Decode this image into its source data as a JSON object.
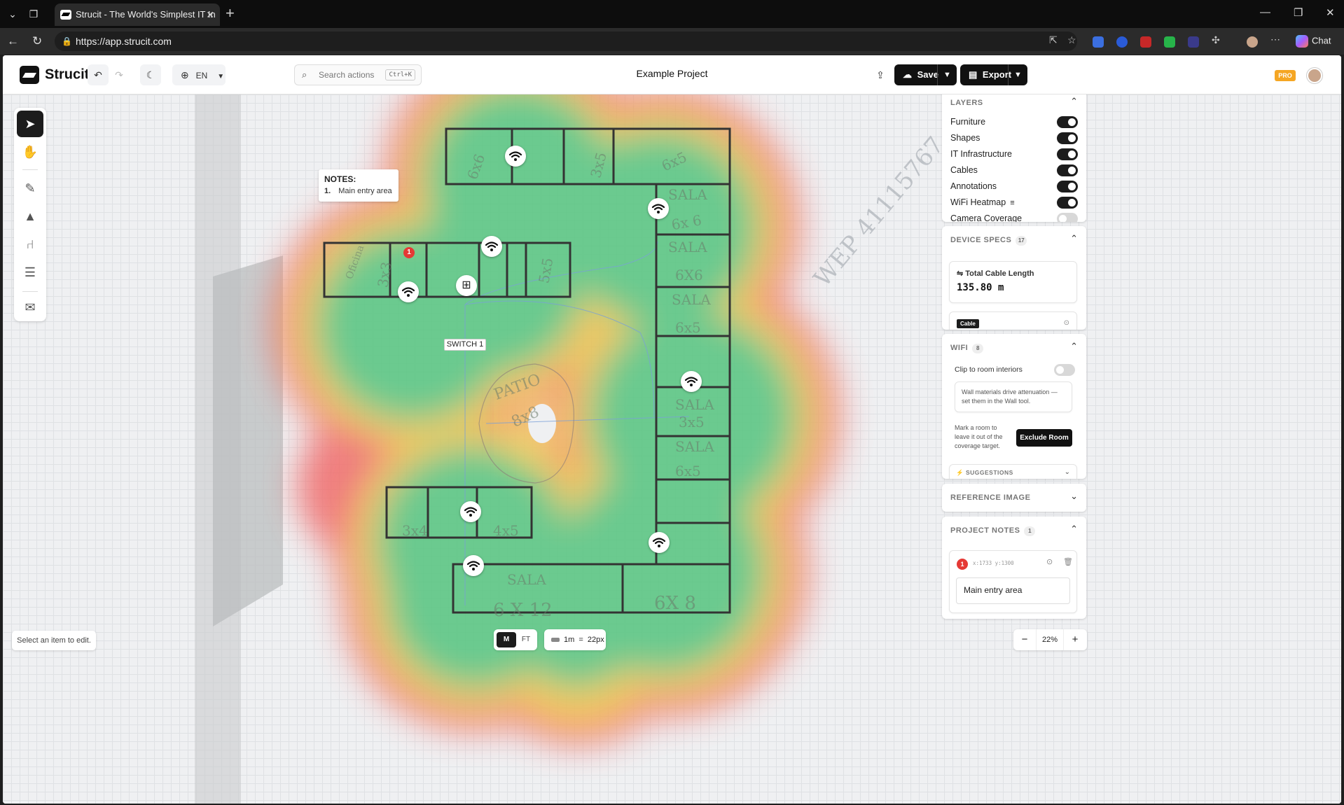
{
  "browser": {
    "tab_title": "Strucit - The World's Simplest IT In",
    "url": "https://app.strucit.com",
    "chat_label": "Chat"
  },
  "app": {
    "logo_text": "Strucit",
    "language": "EN",
    "search_placeholder": "Search actions",
    "search_shortcut": "Ctrl+K",
    "project_title": "Example Project",
    "save_label": "Save",
    "export_label": "Export",
    "plan_badge": "PRO"
  },
  "canvas": {
    "notes_title": "NOTES:",
    "notes_items": [
      {
        "num": "1.",
        "text": "Main entry area"
      }
    ],
    "switch_label": "SWITCH 1",
    "note_marker": "1",
    "handwritten_label": "WEP 41115767",
    "status_text": "Select an item to edit.",
    "units": {
      "metric": "M",
      "imperial": "FT",
      "active": "M"
    },
    "scale_text": "1m  =  22px",
    "zoom": "22%"
  },
  "layers": {
    "title": "LAYERS",
    "items": [
      {
        "label": "Furniture",
        "on": true
      },
      {
        "label": "Shapes",
        "on": true
      },
      {
        "label": "IT Infrastructure",
        "on": true
      },
      {
        "label": "Cables",
        "on": true
      },
      {
        "label": "Annotations",
        "on": true
      },
      {
        "label": "WiFi Heatmap",
        "on": true
      },
      {
        "label": "Camera Coverage",
        "on": false
      }
    ]
  },
  "device_specs": {
    "title": "DEVICE SPECS",
    "count": "17",
    "cable_length_label": "Total Cable Length",
    "cable_length_value": "135.80 m",
    "tag": "Cable"
  },
  "wifi": {
    "title": "WIFI",
    "count": "8",
    "clip_label": "Clip to room interiors",
    "clip_on": false,
    "info_text": "Wall materials drive attenuation — set them in the Wall tool.",
    "exclude_text": "Mark a room to leave it out of the coverage target.",
    "exclude_button": "Exclude Room",
    "suggestions_label": "SUGGESTIONS"
  },
  "reference_image": {
    "title": "REFERENCE IMAGE"
  },
  "project_notes": {
    "title": "PROJECT NOTES",
    "count": "1",
    "marker": "1",
    "coords": "x:1733 y:1300",
    "text": "Main entry area"
  },
  "colors": {
    "accent_dark": "#1c1c1c",
    "pro_badge": "#f5a623",
    "marker_red": "#e53935",
    "heat_green": "#4fc27a",
    "heat_yellow": "#f3e352",
    "heat_red": "#f06a6a"
  }
}
